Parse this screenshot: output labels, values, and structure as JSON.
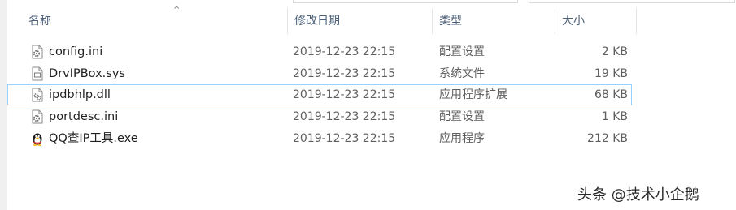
{
  "columns": {
    "name": "名称",
    "date": "修改日期",
    "type": "类型",
    "size": "大小"
  },
  "files": [
    {
      "name": "config.ini",
      "date": "2019-12-23 22:15",
      "type": "配置设置",
      "size": "2 KB",
      "icon": "settings-file-icon"
    },
    {
      "name": "DrvIPBox.sys",
      "date": "2019-12-23 22:15",
      "type": "系统文件",
      "size": "19 KB",
      "icon": "system-file-icon"
    },
    {
      "name": "ipdbhlp.dll",
      "date": "2019-12-23 22:15",
      "type": "应用程序扩展",
      "size": "68 KB",
      "icon": "dll-file-icon"
    },
    {
      "name": "portdesc.ini",
      "date": "2019-12-23 22:15",
      "type": "配置设置",
      "size": "1 KB",
      "icon": "settings-file-icon"
    },
    {
      "name": "QQ查IP工具.exe",
      "date": "2019-12-23 22:15",
      "type": "应用程序",
      "size": "212 KB",
      "icon": "qq-penguin-icon"
    }
  ],
  "watermark": "头条 @技术小企鹅",
  "colors": {
    "header_text": "#4c607a",
    "focus_border": "#99d1ff",
    "secondary_text": "#5f5f5f"
  }
}
